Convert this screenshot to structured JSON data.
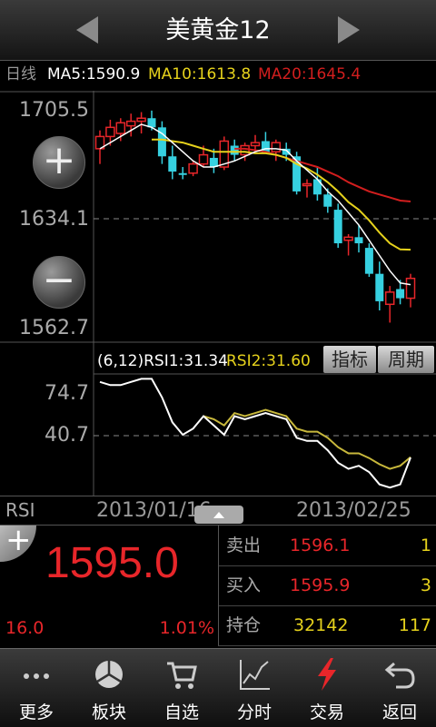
{
  "header": {
    "title": "美黄金12",
    "prev_icon": "triangle-left-icon",
    "next_icon": "triangle-right-icon"
  },
  "ma_row": {
    "period": "日线",
    "ma5": "MA5:1590.9",
    "ma10": "MA10:1613.8",
    "ma20": "MA20:1645.4",
    "colors": {
      "ma5": "#ffffff",
      "ma10": "#e6d21c",
      "ma20": "#d21e1e"
    }
  },
  "price_axis": {
    "top": "1705.5",
    "mid": "1634.1",
    "bottom": "1562.7"
  },
  "rsi_panel": {
    "params": "(6,12)",
    "rsi1": "RSI1:31.34",
    "rsi2": "RSI2:31.60",
    "axis_top": "74.7",
    "axis_mid": "40.7",
    "indicator_btn": "指标",
    "period_btn": "周期"
  },
  "date_row": {
    "label": "RSI",
    "start_date": "2013/01/16",
    "end_date": "2013/02/25"
  },
  "quote": {
    "price": "1595.0",
    "change": "16.0",
    "change_pct": "1.01%"
  },
  "order_book": [
    {
      "label": "卖出",
      "price": "1596.1",
      "volume": "1"
    },
    {
      "label": "买入",
      "price": "1595.9",
      "volume": "3"
    },
    {
      "label": "持仓",
      "price": "32142",
      "volume": "117"
    }
  ],
  "toolbar": [
    {
      "label": "更多",
      "icon": "more-dots-icon"
    },
    {
      "label": "板块",
      "icon": "sector-pie-icon"
    },
    {
      "label": "自选",
      "icon": "cart-icon"
    },
    {
      "label": "分时",
      "icon": "timeline-chart-icon"
    },
    {
      "label": "交易",
      "icon": "lightning-icon"
    },
    {
      "label": "返回",
      "icon": "back-arrow-icon"
    }
  ],
  "chart_data": {
    "type": "candlestick",
    "y_range": [
      1562.7,
      1705.5
    ],
    "y_ticks": [
      1705.5,
      1634.1,
      1562.7
    ],
    "x_dates": [
      "2013/01/16",
      "2013/02/25"
    ],
    "candles": [
      {
        "o": 1680,
        "h": 1692,
        "l": 1670,
        "c": 1688
      },
      {
        "o": 1688,
        "h": 1699,
        "l": 1682,
        "c": 1694
      },
      {
        "o": 1690,
        "h": 1700,
        "l": 1685,
        "c": 1697
      },
      {
        "o": 1695,
        "h": 1703,
        "l": 1688,
        "c": 1698
      },
      {
        "o": 1698,
        "h": 1704,
        "l": 1690,
        "c": 1700
      },
      {
        "o": 1700,
        "h": 1705,
        "l": 1692,
        "c": 1694
      },
      {
        "o": 1694,
        "h": 1698,
        "l": 1670,
        "c": 1675
      },
      {
        "o": 1675,
        "h": 1682,
        "l": 1660,
        "c": 1665
      },
      {
        "o": 1664,
        "h": 1668,
        "l": 1660,
        "c": 1663
      },
      {
        "o": 1664,
        "h": 1672,
        "l": 1662,
        "c": 1670
      },
      {
        "o": 1670,
        "h": 1682,
        "l": 1668,
        "c": 1676
      },
      {
        "o": 1674,
        "h": 1680,
        "l": 1664,
        "c": 1668
      },
      {
        "o": 1668,
        "h": 1688,
        "l": 1666,
        "c": 1685
      },
      {
        "o": 1682,
        "h": 1686,
        "l": 1672,
        "c": 1676
      },
      {
        "o": 1676,
        "h": 1684,
        "l": 1672,
        "c": 1682
      },
      {
        "o": 1682,
        "h": 1689,
        "l": 1678,
        "c": 1684
      },
      {
        "o": 1685,
        "h": 1691,
        "l": 1680,
        "c": 1677
      },
      {
        "o": 1678,
        "h": 1686,
        "l": 1672,
        "c": 1684
      },
      {
        "o": 1680,
        "h": 1684,
        "l": 1672,
        "c": 1676
      },
      {
        "o": 1675,
        "h": 1678,
        "l": 1650,
        "c": 1652
      },
      {
        "o": 1656,
        "h": 1660,
        "l": 1648,
        "c": 1657
      },
      {
        "o": 1660,
        "h": 1668,
        "l": 1646,
        "c": 1650
      },
      {
        "o": 1650,
        "h": 1654,
        "l": 1638,
        "c": 1642
      },
      {
        "o": 1640,
        "h": 1644,
        "l": 1615,
        "c": 1618
      },
      {
        "o": 1620,
        "h": 1624,
        "l": 1610,
        "c": 1622
      },
      {
        "o": 1622,
        "h": 1630,
        "l": 1612,
        "c": 1618
      },
      {
        "o": 1615,
        "h": 1618,
        "l": 1596,
        "c": 1598
      },
      {
        "o": 1598,
        "h": 1606,
        "l": 1574,
        "c": 1580
      },
      {
        "o": 1578,
        "h": 1590,
        "l": 1566,
        "c": 1586
      },
      {
        "o": 1588,
        "h": 1594,
        "l": 1578,
        "c": 1582
      },
      {
        "o": 1582,
        "h": 1598,
        "l": 1576,
        "c": 1595
      }
    ],
    "ma5": [
      1680,
      1684,
      1688,
      1692,
      1696,
      1694,
      1690,
      1684,
      1678,
      1672,
      1668,
      1668,
      1670,
      1672,
      1675,
      1678,
      1680,
      1680,
      1679,
      1672,
      1666,
      1660,
      1652,
      1646,
      1638,
      1630,
      1620,
      1610,
      1600,
      1592,
      1590.9
    ],
    "ma10": [
      null,
      null,
      null,
      null,
      null,
      1686,
      1686,
      1685,
      1684,
      1682,
      1680,
      1678,
      1678,
      1678,
      1678,
      1677,
      1677,
      1676,
      1674,
      1670,
      1667,
      1663,
      1658,
      1652,
      1645,
      1640,
      1633,
      1625,
      1618,
      1614,
      1613.8
    ],
    "ma20": [
      null,
      null,
      null,
      null,
      null,
      null,
      null,
      null,
      null,
      null,
      null,
      null,
      null,
      1680,
      1680,
      1679,
      1678,
      1676,
      1674,
      1672,
      1670,
      1668,
      1665,
      1662,
      1658,
      1655,
      1652,
      1650,
      1648,
      1646,
      1645.4
    ],
    "rsi": {
      "y_ticks": [
        74.7,
        40.7
      ],
      "y_range": [
        8,
        84
      ],
      "rsi1": [
        80,
        78,
        78,
        80,
        82,
        82,
        70,
        54,
        46,
        50,
        58,
        52,
        46,
        58,
        56,
        58,
        60,
        58,
        56,
        44,
        42,
        42,
        36,
        28,
        24,
        26,
        22,
        14,
        12,
        14,
        31.34
      ],
      "rsi2": [
        null,
        null,
        null,
        null,
        null,
        null,
        null,
        null,
        null,
        null,
        58,
        56,
        52,
        60,
        58,
        60,
        62,
        60,
        58,
        50,
        48,
        48,
        44,
        38,
        34,
        34,
        31,
        27,
        24,
        26,
        31.6
      ]
    }
  }
}
